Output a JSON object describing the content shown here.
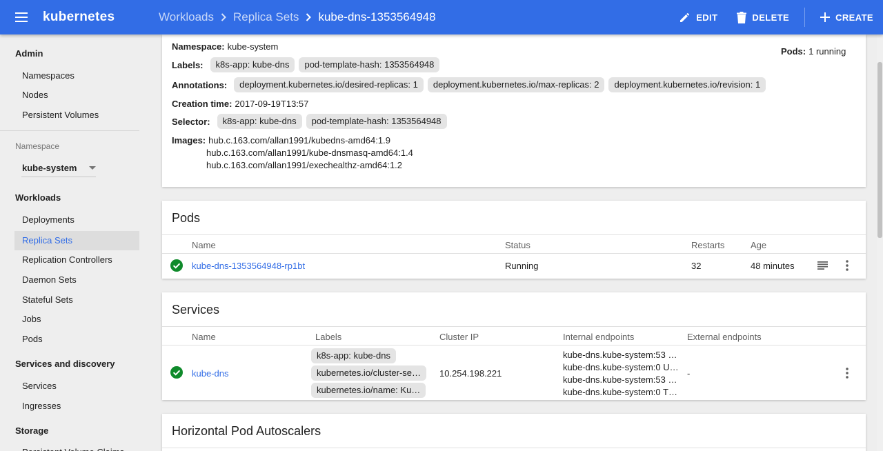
{
  "app": {
    "title": "kubernetes"
  },
  "breadcrumb": [
    "Workloads",
    "Replica Sets",
    "kube-dns-1353564948"
  ],
  "actions": {
    "edit": "EDIT",
    "delete": "DELETE",
    "create": "CREATE"
  },
  "sidebar": {
    "admin": {
      "heading": "Admin",
      "items": [
        "Namespaces",
        "Nodes",
        "Persistent Volumes"
      ]
    },
    "namespace": {
      "label": "Namespace",
      "value": "kube-system"
    },
    "workloads": {
      "heading": "Workloads",
      "items": [
        "Deployments",
        "Replica Sets",
        "Replication Controllers",
        "Daemon Sets",
        "Stateful Sets",
        "Jobs",
        "Pods"
      ]
    },
    "services": {
      "heading": "Services and discovery",
      "items": [
        "Services",
        "Ingresses"
      ]
    },
    "storage": {
      "heading": "Storage",
      "items": [
        "Persistent Volume Claims"
      ]
    }
  },
  "details": {
    "namespace_label": "Namespace:",
    "namespace": "kube-system",
    "pods_label": "Pods:",
    "pods": "1 running",
    "labels_label": "Labels:",
    "labels": [
      "k8s-app: kube-dns",
      "pod-template-hash: 1353564948"
    ],
    "annotations_label": "Annotations:",
    "annotations": [
      "deployment.kubernetes.io/desired-replicas: 1",
      "deployment.kubernetes.io/max-replicas: 2",
      "deployment.kubernetes.io/revision: 1"
    ],
    "creation_label": "Creation time:",
    "creation_time": "2017-09-19T13:57",
    "selector_label": "Selector:",
    "selector": [
      "k8s-app: kube-dns",
      "pod-template-hash: 1353564948"
    ],
    "images_label": "Images:",
    "images": [
      "hub.c.163.com/allan1991/kubedns-amd64:1.9",
      "hub.c.163.com/allan1991/kube-dnsmasq-amd64:1.4",
      "hub.c.163.com/allan1991/exechealthz-amd64:1.2"
    ]
  },
  "pods": {
    "title": "Pods",
    "columns": [
      "Name",
      "Status",
      "Restarts",
      "Age"
    ],
    "rows": [
      {
        "name": "kube-dns-1353564948-rp1bt",
        "status": "Running",
        "restarts": "32",
        "age": "48 minutes"
      }
    ]
  },
  "services": {
    "title": "Services",
    "columns": [
      "Name",
      "Labels",
      "Cluster IP",
      "Internal endpoints",
      "External endpoints"
    ],
    "rows": [
      {
        "name": "kube-dns",
        "labels": [
          "k8s-app: kube-dns",
          "kubernetes.io/cluster-se…",
          "kubernetes.io/name: Ku…"
        ],
        "cluster_ip": "10.254.198.221",
        "internal_endpoints": [
          "kube-dns.kube-system:53 …",
          "kube-dns.kube-system:0 U…",
          "kube-dns.kube-system:53 …",
          "kube-dns.kube-system:0 T…"
        ],
        "external_endpoints": "-"
      }
    ]
  },
  "hpa": {
    "title": "Horizontal Pod Autoscalers"
  },
  "colors": {
    "primary": "#326de6",
    "success": "#0f8a2b",
    "chip": "#e4e4e4"
  }
}
